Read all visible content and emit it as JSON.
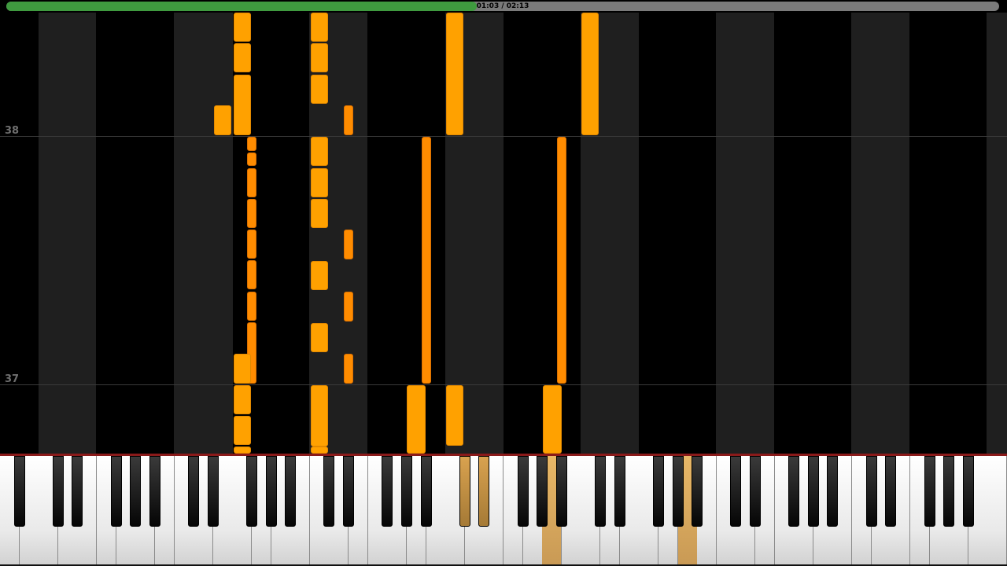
{
  "playback": {
    "time_display": "01:03 / 02:13",
    "current_time": "01:03",
    "total_time": "02:13",
    "progress_fraction": 0.474
  },
  "piano_roll": {
    "measure_labels": [
      "38",
      "37"
    ]
  },
  "colors": {
    "note_white": "#ffa100",
    "note_black": "#ff8c00",
    "progress_fill": "#3f9a3f",
    "progress_track": "#7a7a7a",
    "pressed_key": "#d9a95e",
    "keyline": "#8a1a1a"
  },
  "keyboard": {
    "pressed_keys": [
      "C#4",
      "D#4",
      "A4",
      "A5"
    ]
  }
}
